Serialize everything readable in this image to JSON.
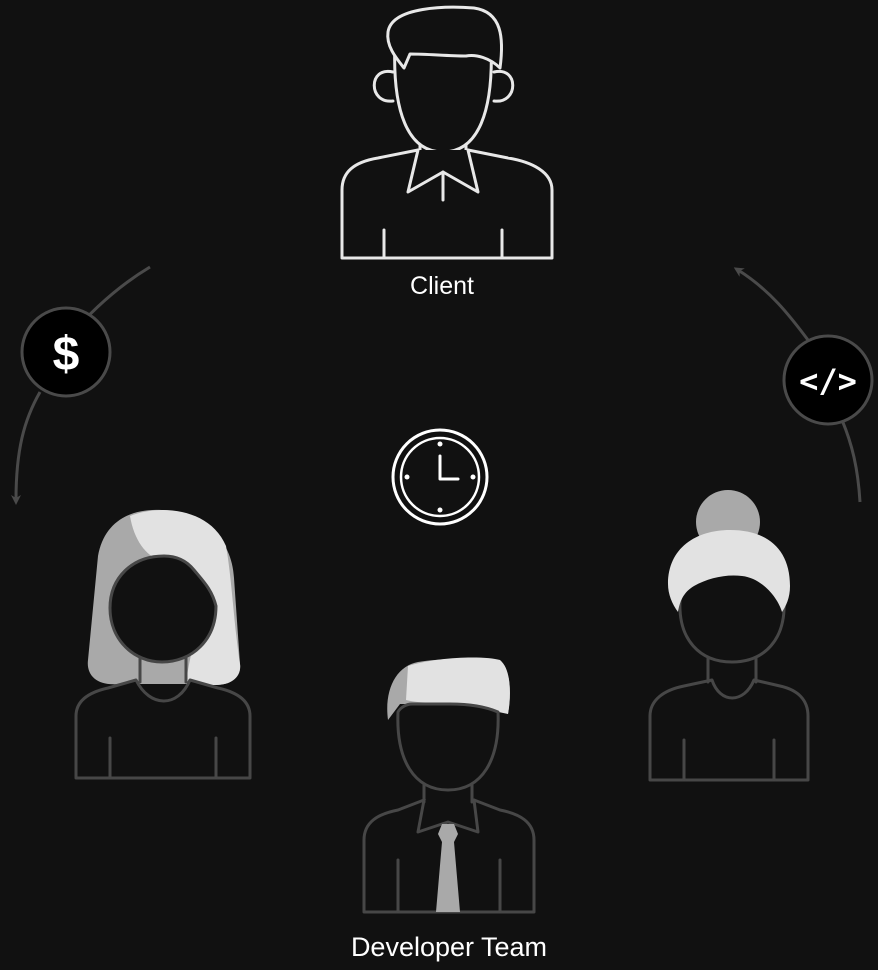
{
  "nodes": {
    "client": {
      "label": "Client",
      "icon": "client-person-icon"
    },
    "team": {
      "label": "Developer Team",
      "members": [
        {
          "icon": "developer-woman-long-hair-icon"
        },
        {
          "icon": "developer-man-tie-icon"
        },
        {
          "icon": "developer-woman-bun-icon"
        }
      ]
    }
  },
  "center": {
    "icon": "clock-icon"
  },
  "edges": [
    {
      "from": "client",
      "to": "team",
      "icon": "dollar-icon",
      "glyph": "$"
    },
    {
      "from": "team",
      "to": "client",
      "icon": "code-icon",
      "glyph": "</>"
    }
  ],
  "colors": {
    "background": "#111111",
    "client_stroke": "#e8e8e8",
    "team_stroke": "#474747",
    "hair_light": "#e2e2e2",
    "hair_shadow": "#a9a9a9",
    "arrow": "#4a4a4a",
    "badge_fill": "#000000",
    "badge_ring": "#4a4a4a",
    "text": "#ffffff"
  }
}
